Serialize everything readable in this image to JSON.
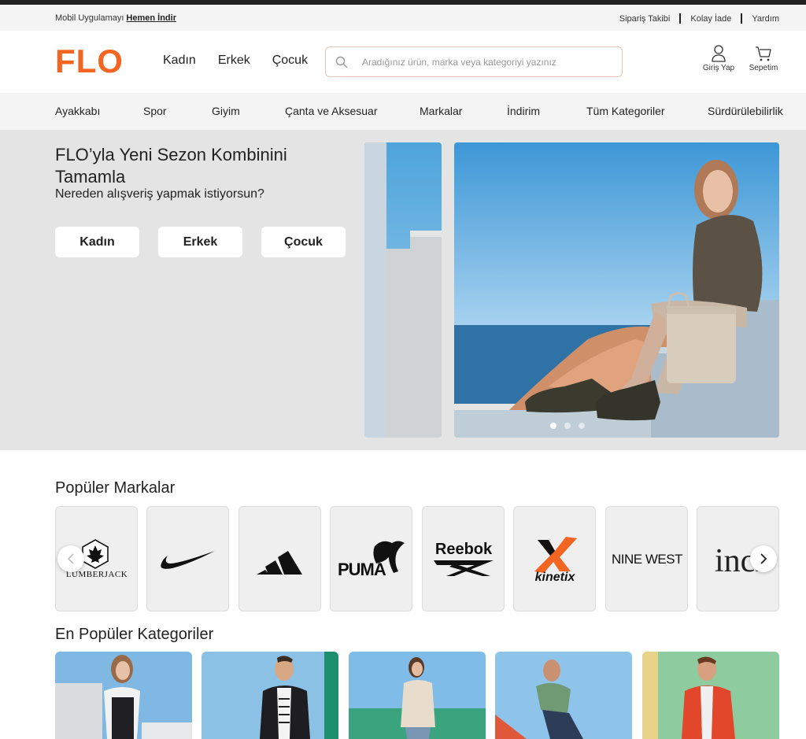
{
  "top_bar": {
    "app_text": "Mobil Uygulamayı",
    "app_link": "Hemen İndir",
    "links": [
      "Sipariş Takibi",
      "Kolay İade",
      "Yardım"
    ]
  },
  "header": {
    "logo_text": "FLO",
    "nav": [
      "Kadın",
      "Erkek",
      "Çocuk"
    ],
    "search_placeholder": "Aradığınız ürün, marka veya kategoriyi yazınız",
    "account_label": "Giriş Yap",
    "cart_label": "Sepetim"
  },
  "categories": [
    "Ayakkabı",
    "Spor",
    "Giyim",
    "Çanta ve Aksesuar",
    "Markalar",
    "İndirim",
    "Tüm Kategoriler",
    "Sürdürülebilirlik"
  ],
  "hero": {
    "title": "FLO’yla Yeni Sezon Kombinini Tamamla",
    "subtitle": "Nereden alışveriş yapmak istiyorsun?",
    "buttons": [
      "Kadın",
      "Erkek",
      "Çocuk"
    ],
    "carousel_dots": 3,
    "active_dot": 0
  },
  "brands_section": {
    "title": "Popüler Markalar",
    "brands": [
      "LUMBERJACK",
      "Nike",
      "adidas",
      "PUMA",
      "Reebok",
      "kinetix",
      "NINE WEST",
      "inci"
    ]
  },
  "categories_section": {
    "title": "En Popüler Kategoriler"
  },
  "colors": {
    "brand": "#f26522",
    "text": "#222222",
    "hero_bg": "#e4e4e4",
    "bar_bg": "#f4f4f4"
  }
}
